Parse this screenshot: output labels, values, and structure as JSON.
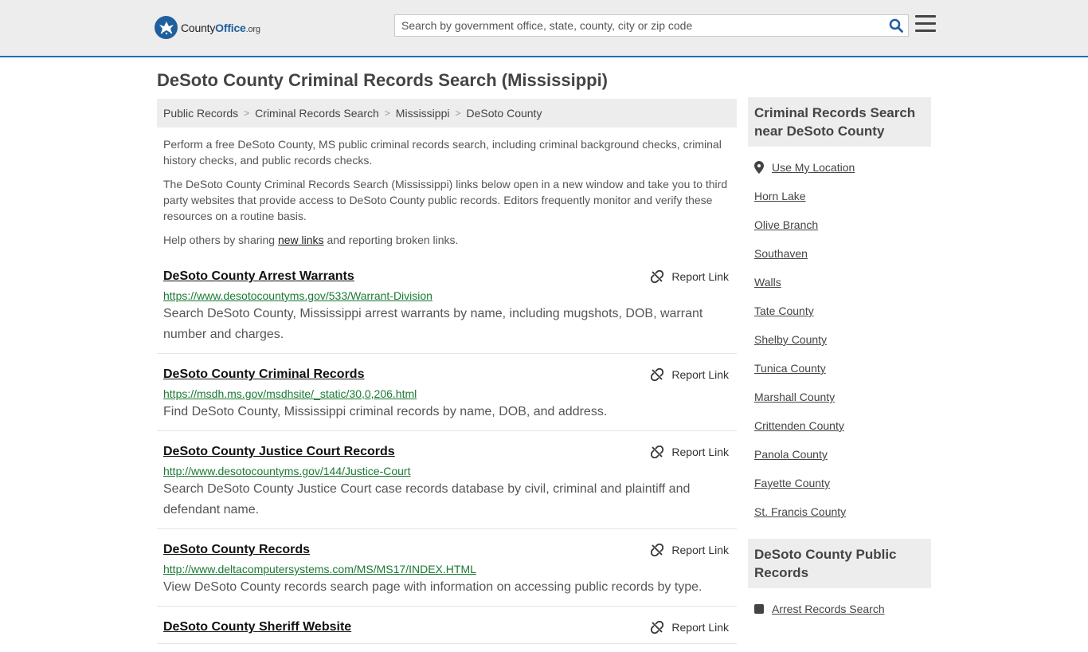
{
  "header": {
    "logo": {
      "prefix": "County",
      "brand": "Office",
      "suffix": ".org"
    },
    "search": {
      "placeholder": "Search by government office, state, county, city or zip code"
    },
    "icons": {
      "search": "search-icon",
      "menu": "hamburger-menu-icon"
    },
    "accent_color": "#1f6fb7"
  },
  "page_title": "DeSoto County Criminal Records Search (Mississippi)",
  "breadcrumb": [
    {
      "label": "Public Records"
    },
    {
      "label": "Criminal Records Search"
    },
    {
      "label": "Mississippi"
    },
    {
      "label": "DeSoto County"
    }
  ],
  "intro": {
    "p1": "Perform a free DeSoto County, MS public criminal records search, including criminal background checks, criminal history checks, and public records checks.",
    "p2": "The DeSoto County Criminal Records Search (Mississippi) links below open in a new window and take you to third party websites that provide access to DeSoto County public records. Editors frequently monitor and verify these resources on a routine basis.",
    "p3_before": "Help others by sharing ",
    "p3_link": "new links",
    "p3_after": " and reporting broken links."
  },
  "report_label": "Report Link",
  "records": [
    {
      "title": "DeSoto County Arrest Warrants",
      "url": "https://www.desotocountyms.gov/533/Warrant-Division",
      "description": "Search DeSoto County, Mississippi arrest warrants by name, including mugshots, DOB, warrant number and charges."
    },
    {
      "title": "DeSoto County Criminal Records",
      "url": "https://msdh.ms.gov/msdhsite/_static/30,0,206.html",
      "description": "Find DeSoto County, Mississippi criminal records by name, DOB, and address."
    },
    {
      "title": "DeSoto County Justice Court Records",
      "url": "http://www.desotocountyms.gov/144/Justice-Court",
      "description": "Search DeSoto County Justice Court case records database by civil, criminal and plaintiff and defendant name."
    },
    {
      "title": "DeSoto County Records",
      "url": "http://www.deltacomputersystems.com/MS/MS17/INDEX.HTML",
      "description": "View DeSoto County records search page with information on accessing public records by type."
    },
    {
      "title": "DeSoto County Sheriff Website",
      "url": "",
      "description": ""
    }
  ],
  "sidebar": {
    "nearby_heading": "Criminal Records Search near DeSoto County",
    "use_location": "Use My Location",
    "nearby": [
      "Horn Lake",
      "Olive Branch",
      "Southaven",
      "Walls",
      "Tate County",
      "Shelby County",
      "Tunica County",
      "Marshall County",
      "Crittenden County",
      "Panola County",
      "Fayette County",
      "St. Francis County"
    ],
    "public_heading": "DeSoto County Public Records",
    "public_items": [
      "Arrest Records Search"
    ]
  }
}
